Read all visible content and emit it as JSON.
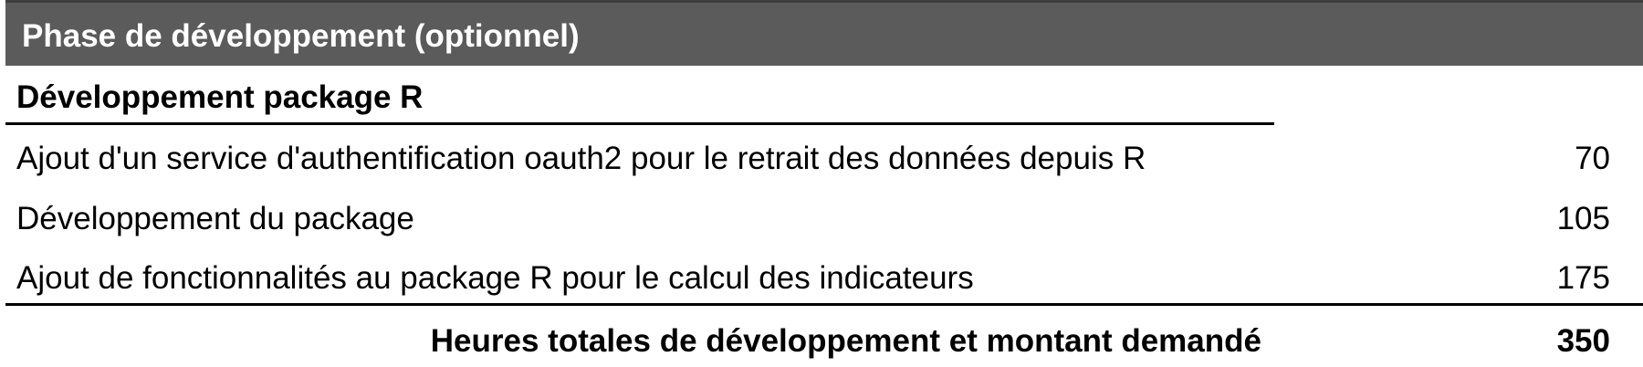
{
  "header": {
    "title": "Phase de développement (optionnel)"
  },
  "section": {
    "title": "Développement package R"
  },
  "rows": [
    {
      "label": "Ajout d'un service d'authentification oauth2 pour le retrait des données depuis R",
      "value": "70"
    },
    {
      "label": "Développement du package",
      "value": "105"
    },
    {
      "label": "Ajout de fonctionnalités au package R pour le calcul des indicateurs",
      "value": "175"
    }
  ],
  "total": {
    "label": "Heures totales de développement et montant demandé",
    "value": "350"
  },
  "colors": {
    "header_background": "#5b5b5b",
    "header_text": "#ffffff",
    "text": "#000000",
    "rule": "#000000"
  }
}
